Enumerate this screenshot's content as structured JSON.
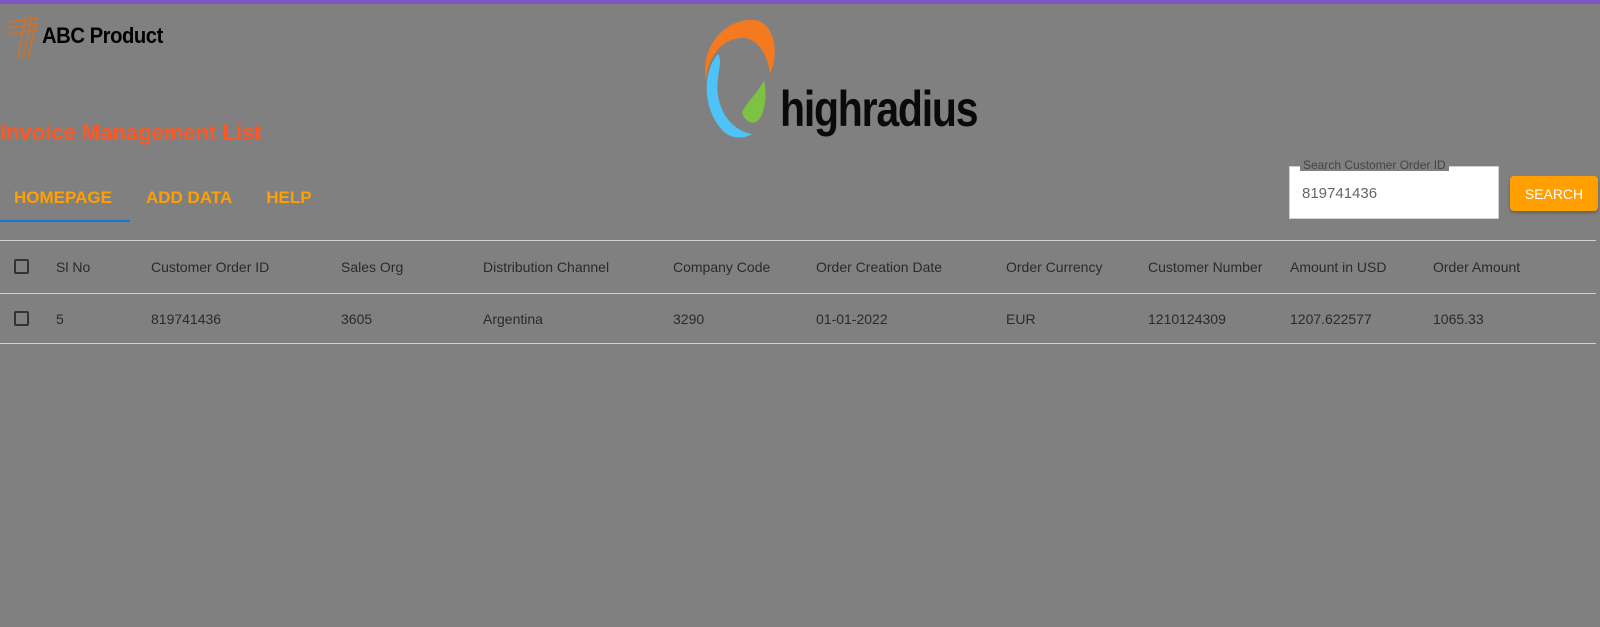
{
  "brand": {
    "product_name": "ABC Product",
    "company_name": "highradius",
    "accent_purple": "#7e57c2",
    "title_orange": "#ff5722",
    "tab_orange": "#ffa000",
    "tab_active_underline": "#1976d2"
  },
  "page": {
    "title": "Invoice Management List"
  },
  "tabs": [
    {
      "label": "HOMEPAGE",
      "active": true
    },
    {
      "label": "ADD DATA",
      "active": false
    },
    {
      "label": "HELP",
      "active": false
    }
  ],
  "search": {
    "legend": "Search Customer Order ID",
    "value": "819741436",
    "button_label": "SEARCH"
  },
  "table": {
    "columns": [
      "Sl No",
      "Customer Order ID",
      "Sales Org",
      "Distribution Channel",
      "Company Code",
      "Order Creation Date",
      "Order Currency",
      "Customer Number",
      "Amount in USD",
      "Order Amount"
    ],
    "rows": [
      {
        "checked": false,
        "cells": [
          "5",
          "819741436",
          "3605",
          "Argentina",
          "3290",
          "01-01-2022",
          "EUR",
          "1210124309",
          "1207.622577",
          "1065.33"
        ]
      }
    ],
    "select_all_checked": false
  },
  "icons": {
    "abc_logo": "stylized-lines-logo-icon",
    "highradius_logo": "highradius-swirl-logo-icon",
    "checkbox": "checkbox-icon"
  }
}
